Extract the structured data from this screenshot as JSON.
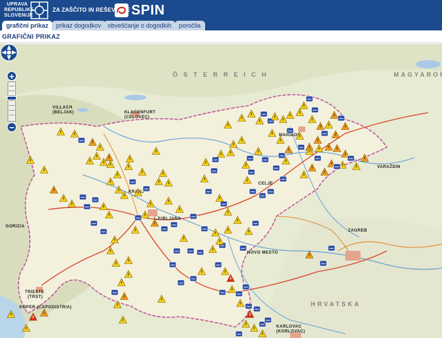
{
  "header": {
    "org_line1": "UPRAVA",
    "org_line2": "REPUBLIKE",
    "org_line3": "SLOVENIJE",
    "org_sub": "ZA ZAŠČITO IN REŠEVANJE",
    "app_name": "SPIN",
    "brand_color": "#1b4a8e"
  },
  "tabs": [
    {
      "label": "grafični prikaz",
      "active": true
    },
    {
      "label": "prikaz dogodkov",
      "active": false
    },
    {
      "label": "obveščanje o dogodkih",
      "active": false
    },
    {
      "label": "poročila",
      "active": false
    }
  ],
  "page_title": "GRAFIČNI PRIKAZ",
  "map": {
    "controls": {
      "nav_icon": "pan-compass-icon",
      "zoom_in_label": "+",
      "zoom_out_label": "−"
    },
    "labels": [
      {
        "text": "Ö S T E R R E I C H",
        "kind": "country"
      },
      {
        "text": "KLAGENFURT",
        "kind": "city"
      },
      {
        "text": "(CELOVEC)",
        "kind": "city"
      },
      {
        "text": "VILLACH",
        "kind": "city"
      },
      {
        "text": "(BELJAK)",
        "kind": "city"
      },
      {
        "text": "LJUBLJANA",
        "kind": "city"
      },
      {
        "text": "ZAGREB",
        "kind": "city"
      },
      {
        "text": "TRIESTE",
        "kind": "city"
      },
      {
        "text": "(TRST)",
        "kind": "city"
      },
      {
        "text": "KOPER (CAPODISTRIA)",
        "kind": "city"
      },
      {
        "text": "KARLOVAC",
        "kind": "city"
      },
      {
        "text": "(KORLOVAC)",
        "kind": "city"
      },
      {
        "text": "CELJE",
        "kind": "city"
      },
      {
        "text": "MARIBOR",
        "kind": "city"
      },
      {
        "text": "KRANJ",
        "kind": "city"
      },
      {
        "text": "NOVO MESTO",
        "kind": "city"
      },
      {
        "text": "GORIZIA",
        "kind": "city"
      },
      {
        "text": "VARAŽDIN",
        "kind": "city"
      },
      {
        "text": "HRVATSKA",
        "kind": "country"
      },
      {
        "text": "MAGYARORSZÁG",
        "kind": "country"
      }
    ],
    "legend_colors": {
      "warning_yellow": "#f7d117",
      "warning_orange": "#f39a1c",
      "alert_red": "#e0251b",
      "event_blue": "#2a4aa0"
    }
  }
}
